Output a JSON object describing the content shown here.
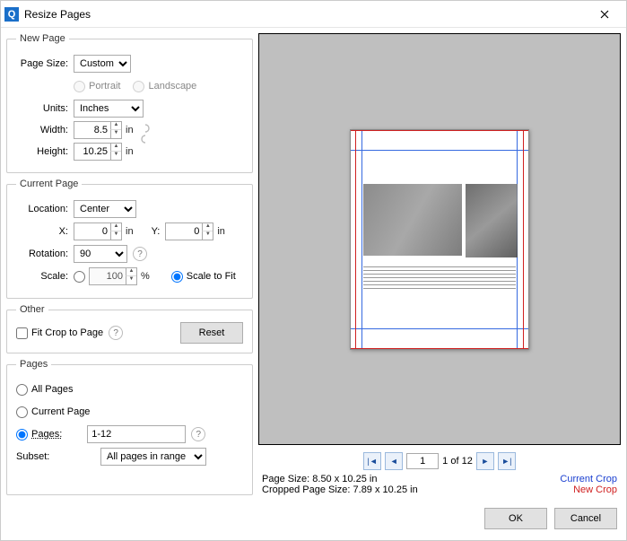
{
  "window": {
    "title": "Resize Pages"
  },
  "newPage": {
    "legend": "New Page",
    "pageSizeLabel": "Page Size:",
    "pageSizeValue": "Custom",
    "portrait": "Portrait",
    "landscape": "Landscape",
    "unitsLabel": "Units:",
    "unitsValue": "Inches",
    "widthLabel": "Width:",
    "widthValue": "8.5",
    "heightLabel": "Height:",
    "heightValue": "10.25",
    "suffix": "in"
  },
  "currentPage": {
    "legend": "Current Page",
    "locationLabel": "Location:",
    "locationValue": "Center",
    "xLabel": "X:",
    "xValue": "0",
    "yLabel": "Y:",
    "yValue": "0",
    "suffix": "in",
    "rotationLabel": "Rotation:",
    "rotationValue": "90",
    "scaleLabel": "Scale:",
    "scaleValue": "100",
    "scaleSuffix": "%",
    "scaleToFit": "Scale to Fit"
  },
  "other": {
    "legend": "Other",
    "fitCrop": "Fit Crop to Page",
    "reset": "Reset"
  },
  "pages": {
    "legend": "Pages",
    "all": "All Pages",
    "current": "Current Page",
    "pagesLabel": "Pages:",
    "range": "1-12",
    "subsetLabel": "Subset:",
    "subsetValue": "All pages in range"
  },
  "nav": {
    "page": "1",
    "of": "1 of 12"
  },
  "status": {
    "pageSizeLabel": "Page Size:",
    "pageSizeValue": "8.50 x 10.25 in",
    "croppedLabel": "Cropped Page Size:",
    "croppedValue": "7.89 x 10.25 in",
    "currentCrop": "Current Crop",
    "newCrop": "New Crop"
  },
  "footer": {
    "ok": "OK",
    "cancel": "Cancel"
  }
}
